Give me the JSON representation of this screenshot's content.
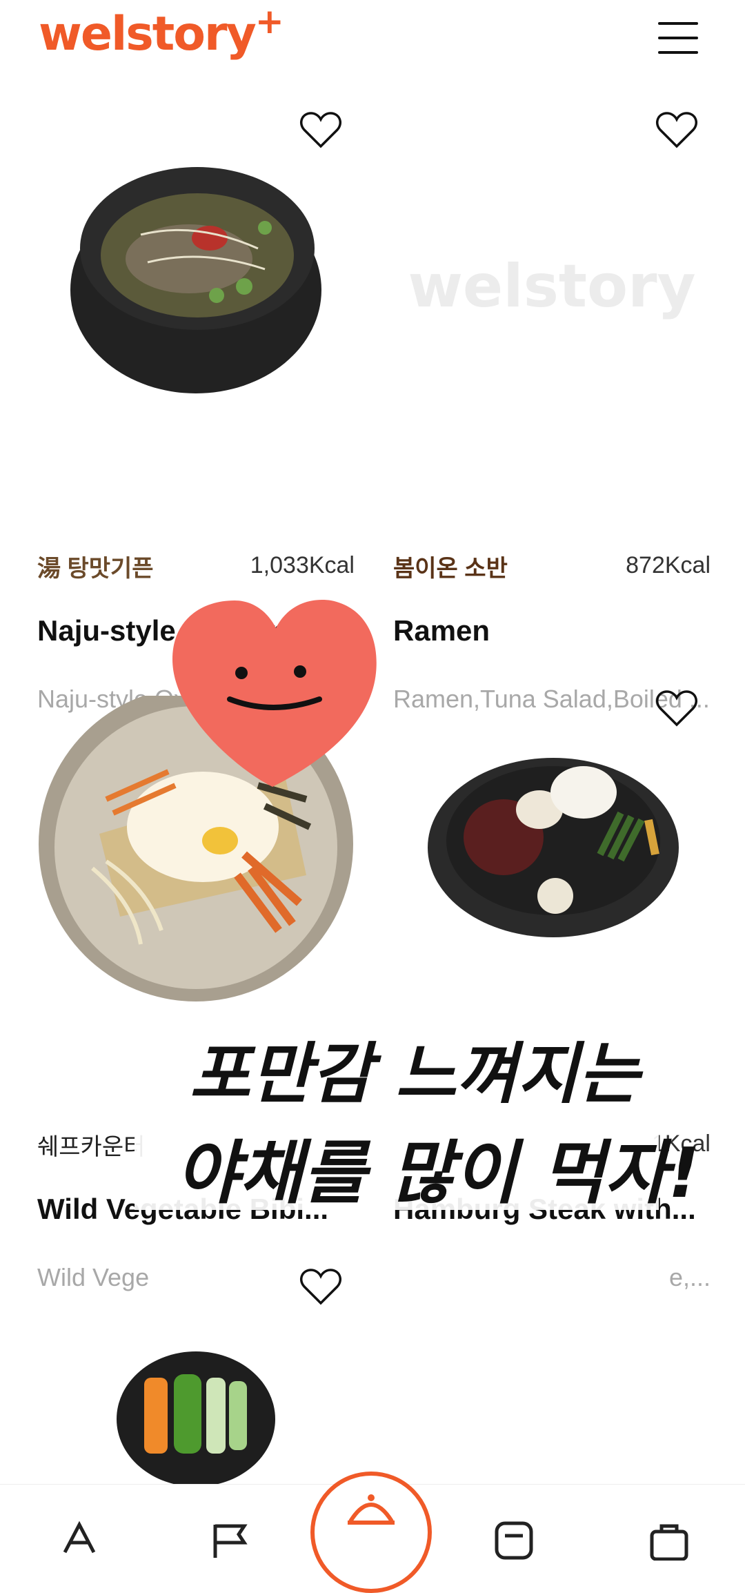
{
  "theme": {
    "brand": "#F05A28",
    "heart_sticker": "#F26A5D"
  },
  "header": {
    "logo_text": "welstory",
    "logo_plus": "+"
  },
  "placeholder_text": "welstory",
  "menus": [
    {
      "brand": "湯 탕맛기픈",
      "kcal": "1,033Kcal",
      "name": "Naju-style Ox Bone ...",
      "desc": "Naju-style Ox Bone Soup ..."
    },
    {
      "brand": "봄이온 소반",
      "kcal": "872Kcal",
      "name": "Ramen",
      "desc": "Ramen,Tuna Salad,Boiled ..."
    },
    {
      "brand": "쉐프카운터",
      "kcal": "1Kcal",
      "name": "Wild Vegetable Bibi...",
      "desc": "Wild Vege"
    },
    {
      "brand": "",
      "kcal": "",
      "name": "Hamburg Steak with...",
      "desc": "e,..."
    }
  ],
  "overlay": {
    "line1": "포만감 느껴지는",
    "line2": "야채를 많이 먹자!"
  },
  "icons": {
    "menu": "hamburger-menu-icon",
    "favorite": "heart-outline-icon",
    "nav": [
      "font-icon",
      "flag-icon",
      "cloche-icon",
      "receipt-icon",
      "bag-icon"
    ]
  }
}
